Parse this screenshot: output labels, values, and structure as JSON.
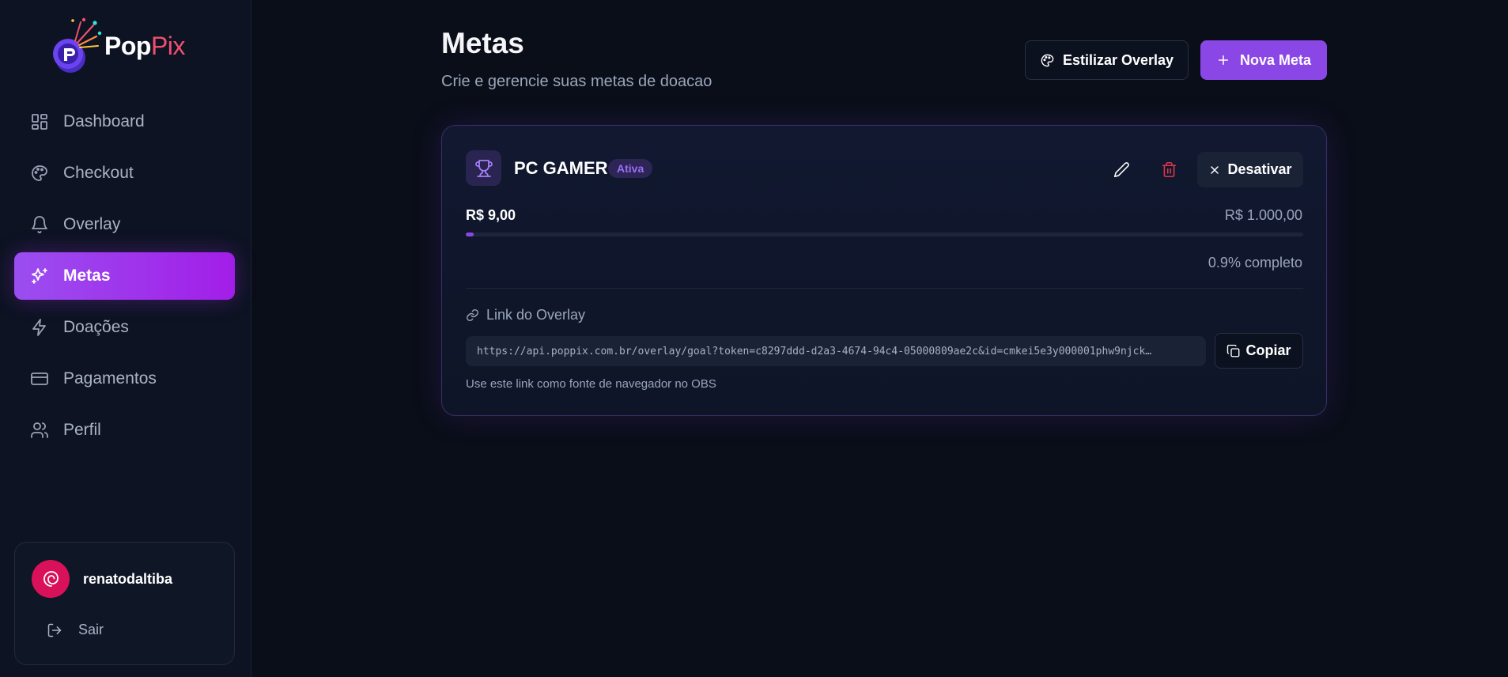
{
  "brand": {
    "name_part1": "Pop",
    "name_part2": "Pix"
  },
  "sidebar": {
    "items": [
      {
        "label": "Dashboard",
        "icon": "dashboard-icon"
      },
      {
        "label": "Checkout",
        "icon": "palette-icon"
      },
      {
        "label": "Overlay",
        "icon": "bell-icon"
      },
      {
        "label": "Metas",
        "icon": "sparkles-icon",
        "active": true
      },
      {
        "label": "Doações",
        "icon": "zap-icon"
      },
      {
        "label": "Pagamentos",
        "icon": "credit-card-icon"
      },
      {
        "label": "Perfil",
        "icon": "users-icon"
      }
    ],
    "user": {
      "name": "renatodaltiba",
      "logout_label": "Sair"
    }
  },
  "header": {
    "title": "Metas",
    "subtitle": "Crie e gerencie suas metas de doacao",
    "style_overlay_label": "Estilizar Overlay",
    "new_goal_label": "Nova Meta"
  },
  "goal": {
    "title": "PC GAMER",
    "status": "Ativa",
    "deactivate_label": "Desativar",
    "raised": "R$ 9,00",
    "target": "R$ 1.000,00",
    "progress_fraction": 0.009,
    "percent_label": "0.9% completo",
    "link_label": "Link do Overlay",
    "overlay_url": "https://api.poppix.com.br/overlay/goal?token=c8297ddd-d2a3-4674-94c4-05000809ae2c&id=cmkei5e3y000001phw9njck…",
    "copy_label": "Copiar",
    "hint": "Use este link como fonte de navegador no OBS"
  },
  "colors": {
    "accent": "#8b47e6",
    "active_nav_start": "#9b4ef0",
    "active_nav_end": "#a21ee8",
    "danger": "#e0364c",
    "logo_pix": "#f0506e",
    "avatar": "#d8115a"
  }
}
